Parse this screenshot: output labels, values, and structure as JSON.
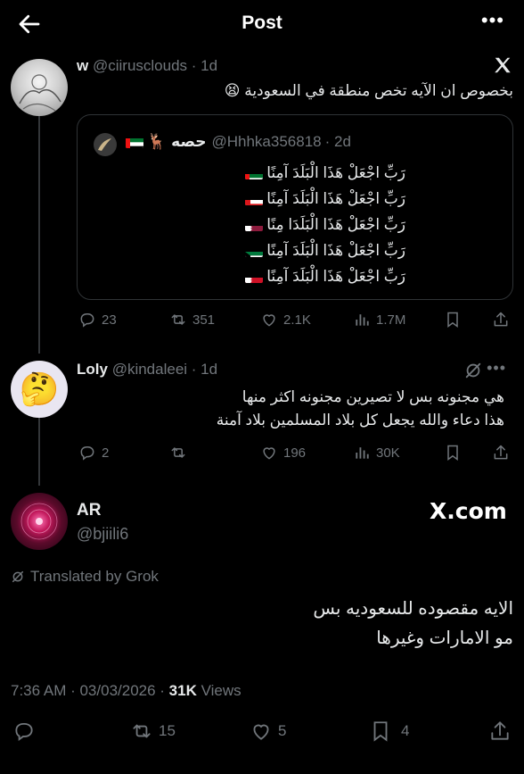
{
  "header": {
    "title": "Post"
  },
  "tweet1": {
    "name": "w",
    "handle": "@ciirusclouds",
    "time": "· 1d",
    "text": "بخصوص ان الآيه تخص منطقة في السعودية 😫",
    "quote": {
      "name": "حصه",
      "emoji": "🦌",
      "handle": "@Hhhka356818",
      "time": "· 2d",
      "lines": [
        "رَبِّ اجْعَلْ هَذَا الْبَلَدَ آمِنًا",
        "رَبِّ اجْعَلْ هَذَا الْبَلَدَ آمِنًا",
        "رَبِّ اجْعَلْ هَذَا الْبَلَدَا مِنًا",
        "رَبِّ اجْعَلْ هَذَا الْبَلَدَ آمِنًا",
        "رَبِّ اجْعَلْ هَذَا الْبَلَدَ آمِنًا"
      ],
      "flags": [
        "uae",
        "oman",
        "qatar",
        "kuwait",
        "bahrain"
      ]
    },
    "actions": {
      "replies": "23",
      "reposts": "351",
      "likes": "2.1K",
      "views": "1.7M"
    }
  },
  "tweet2": {
    "name": "Loly",
    "handle": "@kindaleei",
    "time": "· 1d",
    "avatar_emoji": "🤔",
    "lines": [
      "هي مجنونه بس لا تصيرين مجنونه اكثر منها",
      "هذا دعاء والله يجعل كل بلاد المسلمين بلاد آمنة"
    ],
    "actions": {
      "replies": "2",
      "reposts": "",
      "likes": "196",
      "views": "30K"
    }
  },
  "main": {
    "name": "AR",
    "handle": "@bjiili6",
    "brand": "X.com",
    "translated": "Translated by Grok",
    "lines": [
      "الايه مقصوده للسعوديه بس",
      "مو الامارات وغيرها"
    ],
    "meta": {
      "time": "7:36 AM · 03/03/2026 · ",
      "views_count": "31K",
      "views_label": " Views"
    },
    "actions": {
      "reposts": "15",
      "likes": "5",
      "bookmarks": "4"
    }
  }
}
